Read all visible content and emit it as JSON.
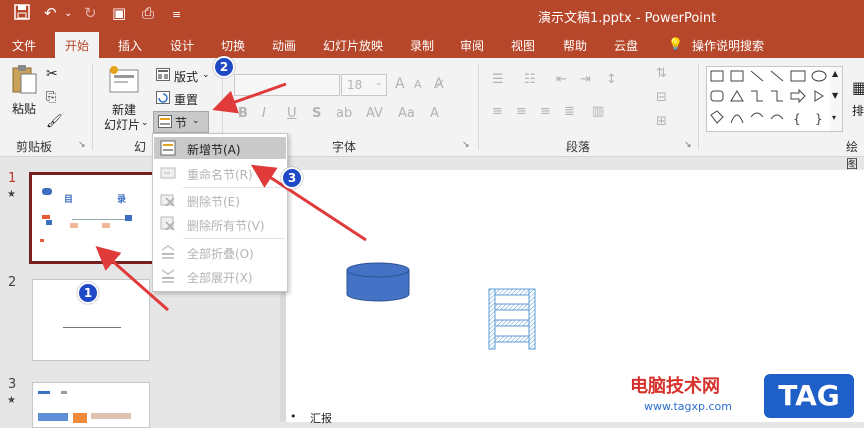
{
  "window": {
    "title": "演示文稿1.pptx  -  PowerPoint"
  },
  "tabs": [
    "文件",
    "开始",
    "插入",
    "设计",
    "切换",
    "动画",
    "幻灯片放映",
    "录制",
    "审阅",
    "视图",
    "帮助",
    "云盘"
  ],
  "help_search": "操作说明搜索",
  "clipboard": {
    "paste": "粘贴",
    "group": "剪贴板"
  },
  "slides": {
    "new_slide_line1": "新建",
    "new_slide_line2": "幻灯片",
    "layout": "版式",
    "reset": "重置",
    "section": "节",
    "group": "幻"
  },
  "font": {
    "size": "18",
    "bold": "B",
    "italic": "I",
    "underline": "U",
    "shadow": "S",
    "group": "字体"
  },
  "paragraph": {
    "group": "段落"
  },
  "drawing": {
    "arrange_partial": "排",
    "group_partial": "绘图"
  },
  "section_menu": {
    "items": [
      {
        "label": "新增节(A)",
        "enabled": true
      },
      {
        "label": "重命名节(R)",
        "enabled": false
      },
      {
        "label": "删除节(E)",
        "enabled": false
      },
      {
        "label": "删除所有节(V)",
        "enabled": false
      },
      {
        "label": "全部折叠(O)",
        "enabled": false
      },
      {
        "label": "全部展开(X)",
        "enabled": false
      }
    ]
  },
  "thumbnails": [
    {
      "number": "1",
      "star": "★",
      "title_left": "目",
      "title_right": "录"
    },
    {
      "number": "2",
      "star": ""
    },
    {
      "number": "3",
      "star": "★"
    }
  ],
  "canvas": {
    "bullet": "汇报"
  },
  "callouts": [
    "1",
    "2",
    "3"
  ],
  "watermark": {
    "text": "电脑技术网",
    "url": "www.tagxp.com",
    "logo": "TAG"
  },
  "colors": {
    "accent": "#b7472a",
    "callout": "#1f49c7",
    "arrow": "#e03a3a"
  }
}
